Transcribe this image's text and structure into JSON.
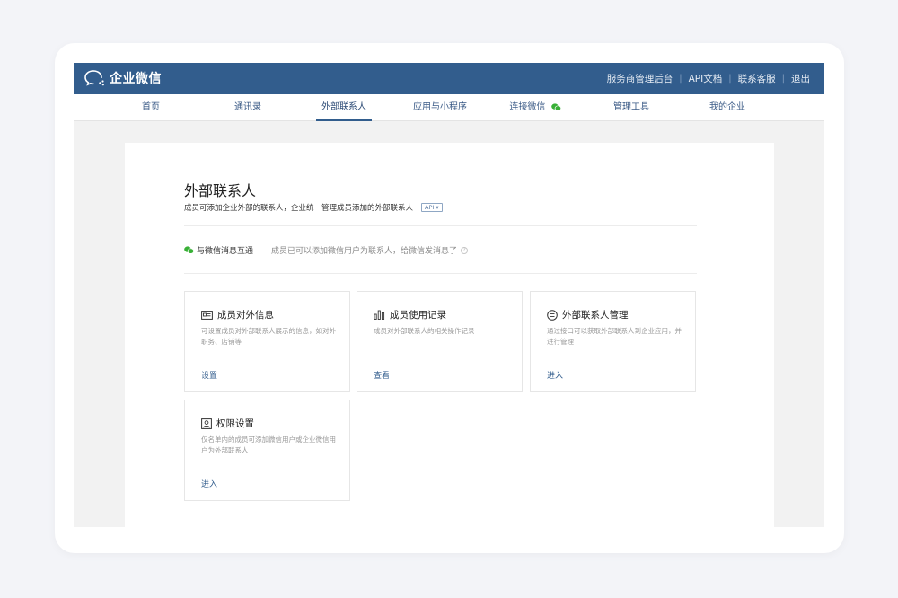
{
  "header": {
    "brand": "企业微信",
    "links": [
      "服务商管理后台",
      "API文档",
      "联系客服",
      "退出"
    ]
  },
  "nav": {
    "items": [
      "首页",
      "通讯录",
      "外部联系人",
      "应用与小程序",
      "连接微信",
      "管理工具",
      "我的企业"
    ],
    "active": "外部联系人"
  },
  "page": {
    "title": "外部联系人",
    "description": "成员可添加企业外部的联系人，企业统一管理成员添加的外部联系人",
    "api_tag": "API",
    "wechat_label": "与微信消息互通",
    "wechat_tip": "成员已可以添加微信用户为联系人，给微信发消息了"
  },
  "cards": [
    {
      "title": "成员对外信息",
      "desc": "可设置成员对外部联系人展示的信息，如对外职务、店铺等",
      "link": "设置",
      "icon": "id-card-icon"
    },
    {
      "title": "成员使用记录",
      "desc": "成员对外部联系人的相关操作记录",
      "link": "查看",
      "icon": "bar-chart-icon"
    },
    {
      "title": "外部联系人管理",
      "desc": "通过接口可以获取外部联系人到企业应用，并进行管理",
      "link": "进入",
      "icon": "chat-manage-icon"
    },
    {
      "title": "权限设置",
      "desc": "仅名单内的成员可添加微信用户或企业微信用户为外部联系人",
      "link": "进入",
      "icon": "user-permission-icon"
    }
  ],
  "colors": {
    "header_bg": "#325d8d",
    "link": "#325d8d",
    "wechat_green": "#38b036"
  }
}
